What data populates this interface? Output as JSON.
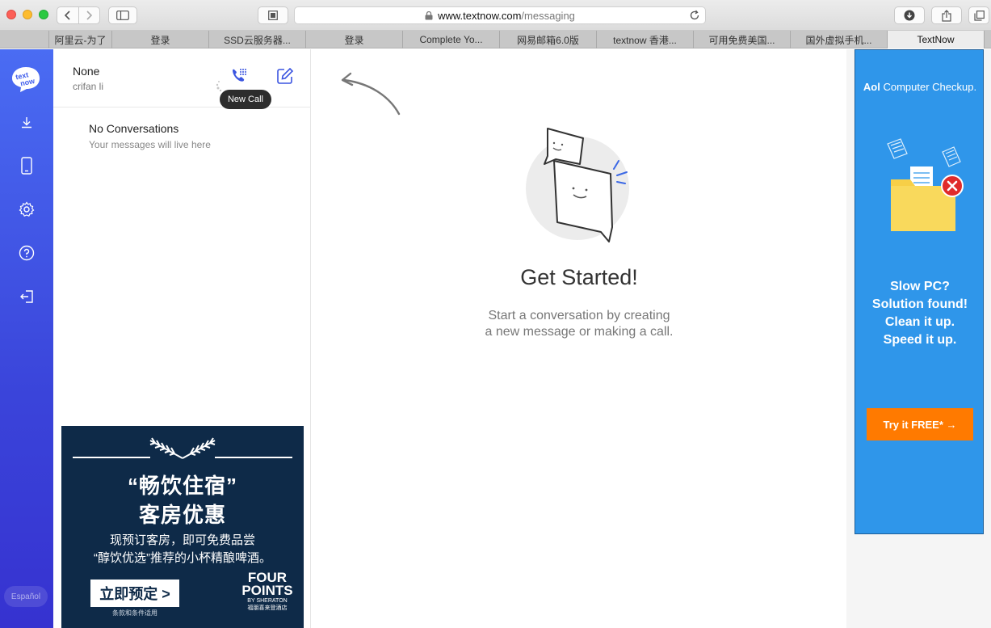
{
  "browser": {
    "url_domain": "www.textnow.com",
    "url_path": "/messaging",
    "tabs": [
      {
        "label": "阿里云-为了"
      },
      {
        "label": "登录"
      },
      {
        "label": "SSD云服务器..."
      },
      {
        "label": "登录"
      },
      {
        "label": "Complete Yo..."
      },
      {
        "label": "网易邮箱6.0版"
      },
      {
        "label": "textnow 香港..."
      },
      {
        "label": "可用免费美国..."
      },
      {
        "label": "国外虚拟手机..."
      },
      {
        "label": "TextNow",
        "active": true
      }
    ]
  },
  "sidebar": {
    "icons": [
      "textnow-logo-icon",
      "download-icon",
      "phone-device-icon",
      "settings-gear-icon",
      "help-icon",
      "logout-icon"
    ],
    "language_label": "Español",
    "color": "#3b4fe0"
  },
  "conversations": {
    "user_name": "None",
    "user_handle": "crifan li",
    "tooltip": "New Call",
    "empty_title": "No Conversations",
    "empty_subtitle": "Your messages will live here"
  },
  "ad_left": {
    "headline_1": "“畅饮住宿”",
    "headline_2": "客房优惠",
    "body_1": "现预订客房，即可免费品尝",
    "body_2": "“醇饮优选”推荐的小杯精酿啤酒。",
    "button": "立即预定 >",
    "terms": "条款和条件适用",
    "brand_line_1": "FOUR",
    "brand_line_2": "POINTS",
    "brand_sub": "BY SHERATON",
    "brand_cn": "福朋喜来登酒店"
  },
  "main": {
    "title": "Get Started!",
    "subtitle_1": "Start a conversation by creating",
    "subtitle_2": "a new message or making a call."
  },
  "ad_right": {
    "brand_logo": "Aol",
    "brand": "Computer Checkup.",
    "headline_1": "Slow PC?",
    "headline_2": "Solution found!",
    "headline_3": "Clean it up.",
    "headline_4": "Speed it up.",
    "button": "Try it FREE* →",
    "accent": "#ff7a00"
  }
}
